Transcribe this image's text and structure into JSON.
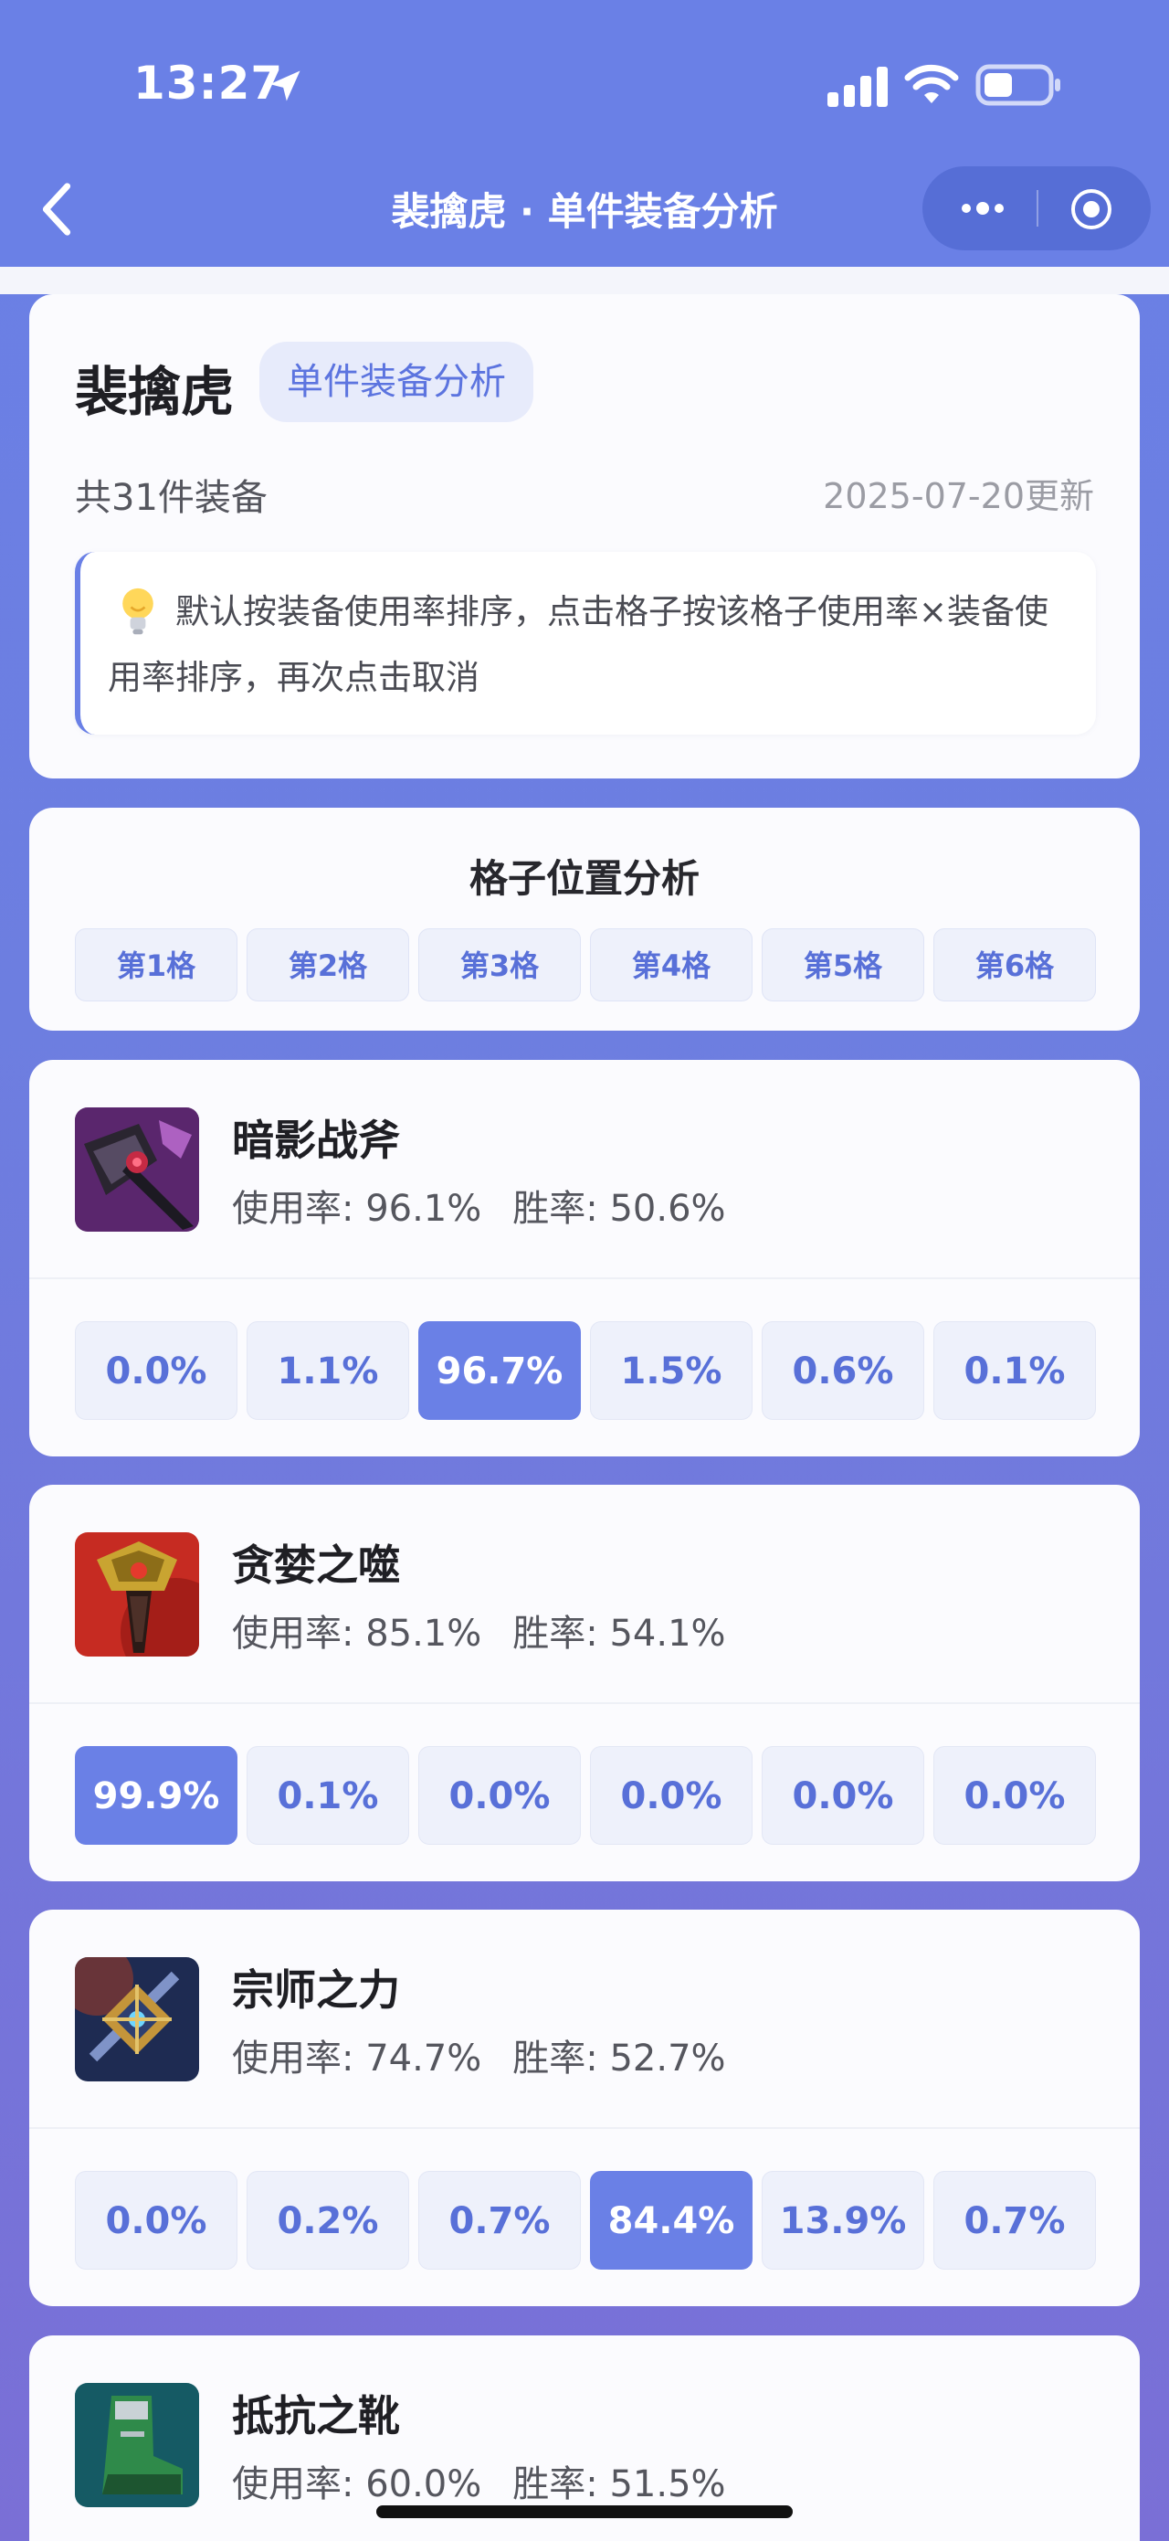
{
  "status_bar": {
    "time": "13:27"
  },
  "nav": {
    "title": "裴擒虎 · 单件装备分析"
  },
  "hero": {
    "name": "裴擒虎",
    "tag": "单件装备分析",
    "count": "共31件装备",
    "updated": "2025-07-20更新",
    "tip": "默认按装备使用率排序，点击格子按该格子使用率×装备使用率排序，再次点击取消"
  },
  "position_analysis": {
    "title": "格子位置分析",
    "slots": [
      "第1格",
      "第2格",
      "第3格",
      "第4格",
      "第5格",
      "第6格"
    ]
  },
  "items": [
    {
      "name": "暗影战斧",
      "usage": "使用率: 96.1%",
      "winrate": "胜率: 50.6%",
      "slots": [
        "0.0%",
        "1.1%",
        "96.7%",
        "1.5%",
        "0.6%",
        "0.1%"
      ],
      "top_slot": 2
    },
    {
      "name": "贪婪之噬",
      "usage": "使用率: 85.1%",
      "winrate": "胜率: 54.1%",
      "slots": [
        "99.9%",
        "0.1%",
        "0.0%",
        "0.0%",
        "0.0%",
        "0.0%"
      ],
      "top_slot": 0
    },
    {
      "name": "宗师之力",
      "usage": "使用率: 74.7%",
      "winrate": "胜率: 52.7%",
      "slots": [
        "0.0%",
        "0.2%",
        "0.7%",
        "84.4%",
        "13.9%",
        "0.7%"
      ],
      "top_slot": 3
    },
    {
      "name": "抵抗之靴",
      "usage": "使用率: 60.0%",
      "winrate": "胜率: 51.5%"
    }
  ],
  "colors": {
    "accent": "#6a80e6",
    "slot_bg": "#eef1fb",
    "text_dark": "#1f1f24"
  }
}
